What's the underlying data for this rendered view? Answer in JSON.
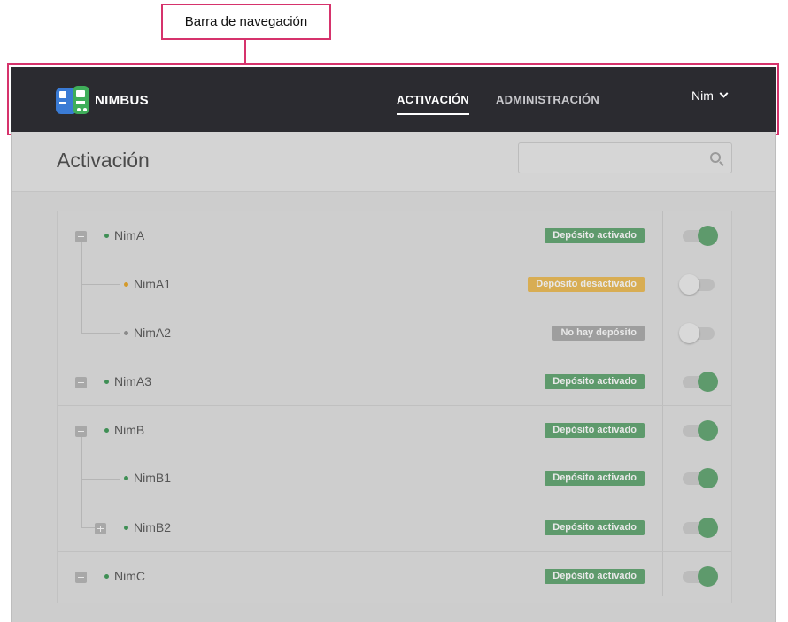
{
  "annotation": {
    "label": "Barra de navegación"
  },
  "navbar": {
    "brand": "NIMBUS",
    "tabs": [
      {
        "label": "ACTIVACIÓN",
        "active": true
      },
      {
        "label": "ADMINISTRACIÓN",
        "active": false
      }
    ],
    "user": "Nim",
    "bg_color": "#2b2b30"
  },
  "page": {
    "title": "Activación",
    "search_placeholder": ""
  },
  "tree": [
    {
      "name": "NimA",
      "expander": "minus",
      "status": "green",
      "badge": "Depósito activado",
      "toggle": true
    },
    {
      "name": "NimA1",
      "expander": null,
      "status": "amber",
      "badge": "Depósito desactivado",
      "toggle": false
    },
    {
      "name": "NimA2",
      "expander": null,
      "status": "gray",
      "badge": "No hay depósito",
      "toggle": false
    },
    {
      "name": "NimA3",
      "expander": "plus",
      "status": "green",
      "badge": "Depósito activado",
      "toggle": true
    },
    {
      "name": "NimB",
      "expander": "minus",
      "status": "green",
      "badge": "Depósito activado",
      "toggle": true
    },
    {
      "name": "NimB1",
      "expander": null,
      "status": "green",
      "badge": "Depósito activado",
      "toggle": true
    },
    {
      "name": "NimB2",
      "expander": "plus",
      "status": "green",
      "badge": "Depósito activado",
      "toggle": true
    },
    {
      "name": "NimC",
      "expander": "plus",
      "status": "green",
      "badge": "Depósito activado",
      "toggle": true
    }
  ],
  "colors": {
    "accent_highlight": "#d6336c",
    "status_green": "#5e9a6c",
    "status_amber": "#d8ad53",
    "status_gray": "#9e9e9e"
  }
}
